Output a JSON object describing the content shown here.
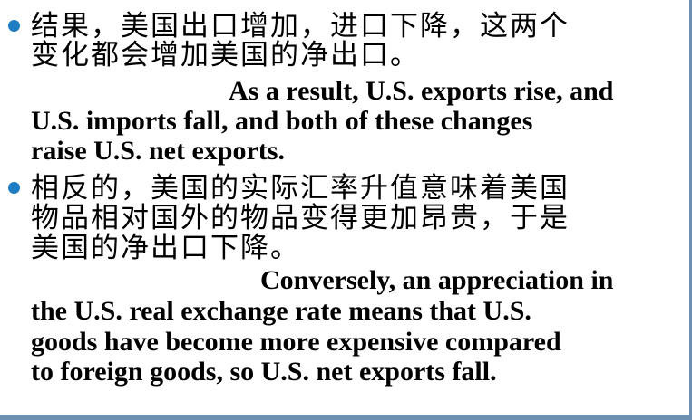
{
  "bullets": [
    {
      "zh_lines": [
        "结果，美国出口增加，进口下降，这两个",
        "变化都会增加美国的净出口。"
      ],
      "en_lines": [
        "As a result, U.S. exports rise, and",
        "U.S. imports fall, and both of these changes",
        "raise U.S. net exports."
      ]
    },
    {
      "zh_lines": [
        "相反的，美国的实际汇率升值意味着美国",
        "物品相对国外的物品变得更加昂贵，于是",
        "美国的净出口下降。"
      ],
      "en_lines": [
        "Conversely, an appreciation in",
        "the U.S. real exchange rate means that U.S.",
        "goods have become more expensive compared",
        "to foreign goods, so U.S. net exports fall."
      ]
    }
  ],
  "colors": {
    "bullet": "#1f7dc4",
    "border": "#6d8fb0",
    "text": "#000000"
  }
}
